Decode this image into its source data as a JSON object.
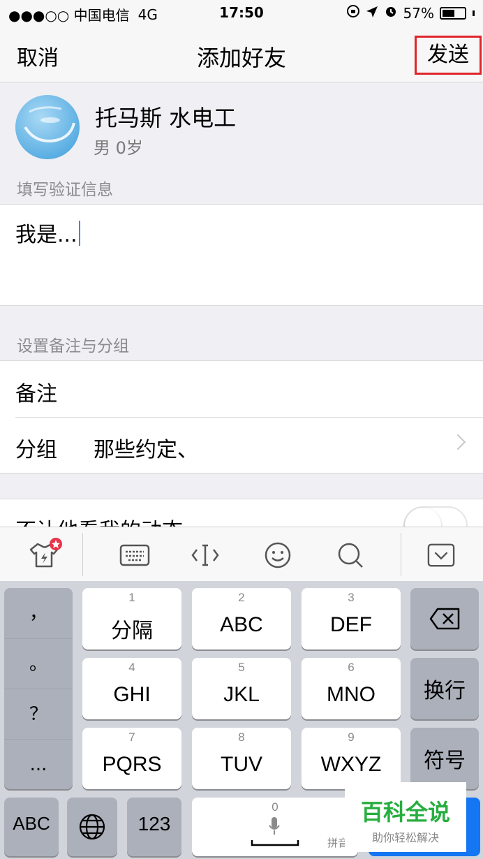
{
  "status_bar": {
    "carrier": "●●●○○ 中国电信",
    "network": "4G",
    "time": "17:50",
    "battery_text": "57%",
    "battery_level": 0.57,
    "icons": [
      "rotation-lock-icon",
      "location-arrow-icon",
      "alarm-icon",
      "battery-icon"
    ]
  },
  "nav": {
    "cancel": "取消",
    "title": "添加好友",
    "send": "发送",
    "highlight_color": "#e0262b"
  },
  "profile": {
    "name": "托马斯  水电工",
    "sub": "男 0岁"
  },
  "verify": {
    "section_label": "填写验证信息",
    "text": "我是..."
  },
  "settings": {
    "section_label": "设置备注与分组",
    "remark_label": "备注",
    "group_label": "分组",
    "group_value": "那些约定、"
  },
  "dynamic": {
    "label": "不让他看我的动态"
  },
  "keyboard": {
    "punctuation": [
      "，",
      "。",
      "？",
      "..."
    ],
    "keys": [
      {
        "num": "1",
        "label": "分隔"
      },
      {
        "num": "2",
        "label": "ABC"
      },
      {
        "num": "3",
        "label": "DEF"
      },
      {
        "num": "4",
        "label": "GHI"
      },
      {
        "num": "5",
        "label": "JKL"
      },
      {
        "num": "6",
        "label": "MNO"
      },
      {
        "num": "7",
        "label": "PQRS"
      },
      {
        "num": "8",
        "label": "TUV"
      },
      {
        "num": "9",
        "label": "WXYZ"
      }
    ],
    "newline": "换行",
    "symbols": "符号",
    "abc": "ABC",
    "num123": "123",
    "space_num": "0",
    "space_label": "拼音"
  },
  "watermark": {
    "main": "百科全说",
    "sub": "助你轻松解决"
  }
}
